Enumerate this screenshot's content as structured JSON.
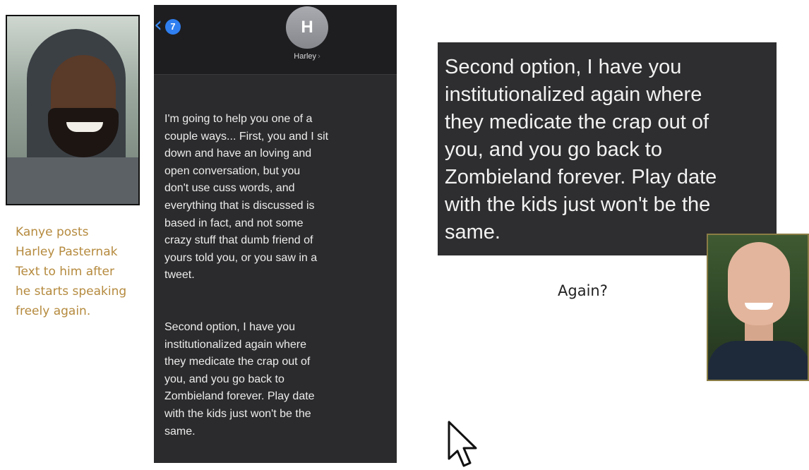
{
  "caption": {
    "lines": [
      "Kanye posts",
      "Harley Pasternak",
      "Text to him after",
      "he starts speaking",
      "freely again."
    ]
  },
  "phone": {
    "back_badge": "7",
    "avatar_initial": "H",
    "contact_name": "Harley",
    "message": {
      "paragraph1": [
        "I'm going to help you one of a",
        "couple ways... First, you and I sit",
        "down and have an loving and",
        "open  conversation, but you",
        "don't use cuss words, and",
        "everything that is discussed is",
        "based in fact, and not some",
        "crazy stuff that dumb friend of",
        "yours told you, or you saw in a",
        "tweet."
      ],
      "paragraph2": [
        "Second option, I have you",
        "institutionalized again where",
        "they medicate the crap out of",
        "you, and you go back to",
        "Zombieland forever. Play date",
        "with the kids just won't be the",
        "same."
      ]
    }
  },
  "zoom": {
    "lines": [
      "Second option, I have you",
      "institutionalized again where",
      "they medicate the crap out of",
      "you, and you go back to",
      "Zombieland forever. Play date",
      "with the kids just won't be the",
      "same."
    ]
  },
  "annotation": "Again?",
  "icons": {
    "back": "chevron-left-icon",
    "contact_chevron": "chevron-right-icon",
    "cursor": "mouse-pointer-icon"
  },
  "colors": {
    "caption": "#b58a3e",
    "imessage_blue": "#2f7ff0",
    "dark_bg": "#2b2b2d"
  }
}
